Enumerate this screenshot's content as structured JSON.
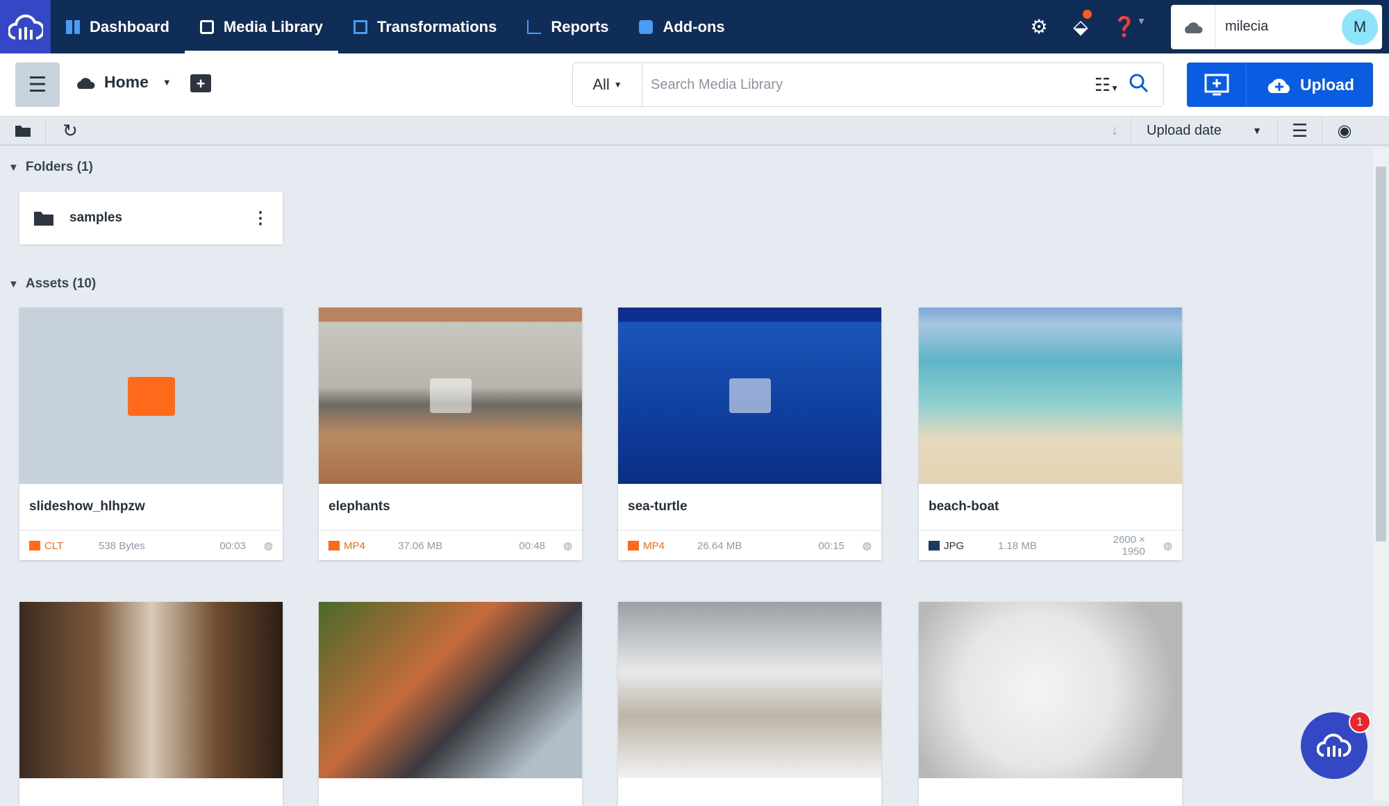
{
  "nav": {
    "items": [
      {
        "label": "Dashboard",
        "icon": "dashboard-icon"
      },
      {
        "label": "Media Library",
        "icon": "media-library-icon",
        "active": true
      },
      {
        "label": "Transformations",
        "icon": "transformations-icon"
      },
      {
        "label": "Reports",
        "icon": "reports-icon"
      },
      {
        "label": "Add-ons",
        "icon": "puzzle-icon"
      }
    ],
    "account": {
      "name": "milecia",
      "initial": "M"
    },
    "accent": "#3448c5",
    "nav_bg": "#0f2d57"
  },
  "toolbar": {
    "home_label": "Home",
    "search_scope": "All",
    "search_placeholder": "Search Media Library",
    "upload_label": "Upload",
    "upload_color": "#0a5ce0"
  },
  "subtoolbar": {
    "sort_label": "Upload date"
  },
  "folders": {
    "header": "Folders (1)",
    "items": [
      {
        "name": "samples"
      }
    ]
  },
  "assets": {
    "header": "Assets (10)",
    "items": [
      {
        "name": "slideshow_hlhpzw",
        "type": "CLT",
        "size": "538 Bytes",
        "detail": "00:03",
        "kind": "video"
      },
      {
        "name": "elephants",
        "type": "MP4",
        "size": "37.06 MB",
        "detail": "00:48",
        "kind": "video"
      },
      {
        "name": "sea-turtle",
        "type": "MP4",
        "size": "26.64 MB",
        "detail": "00:15",
        "kind": "video"
      },
      {
        "name": "beach-boat",
        "type": "JPG",
        "size": "1.18 MB",
        "detail": "2600 × 1950",
        "kind": "image"
      }
    ]
  },
  "chat": {
    "badge": "1"
  }
}
